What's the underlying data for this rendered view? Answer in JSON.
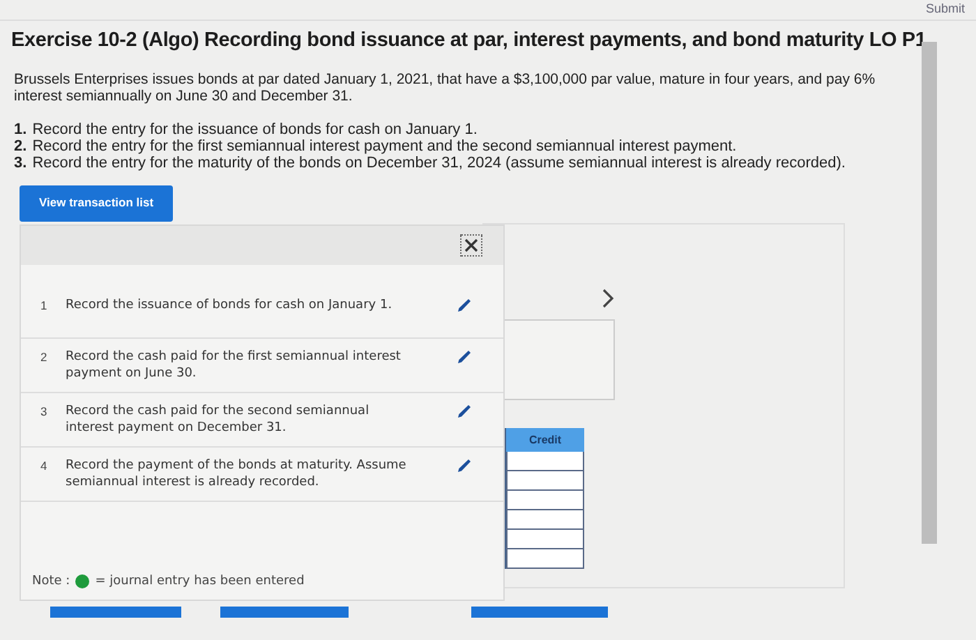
{
  "top_bar": {
    "submit_label": "Submit"
  },
  "title": "Exercise 10-2 (Algo) Recording bond issuance at par, interest payments, and bond maturity LO P1",
  "intro": "Brussels Enterprises issues bonds at par dated January 1, 2021, that have a $3,100,000 par value, mature in four years, and pay 6% interest semiannually on June 30 and December 31.",
  "tasks": [
    {
      "number": "1.",
      "text": "Record the entry for the issuance of bonds for cash on January 1."
    },
    {
      "number": "2.",
      "text": "Record the entry for the first semiannual interest payment and the second semiannual interest payment."
    },
    {
      "number": "3.",
      "text": "Record the entry for the maturity of the bonds on December 31, 2024 (assume semiannual interest is already recorded)."
    }
  ],
  "transaction_button": "View transaction list",
  "transactions": [
    {
      "number": "1",
      "text": "Record the issuance of bonds for cash on January 1."
    },
    {
      "number": "2",
      "text": "Record the cash paid for the first semiannual interest payment on June 30."
    },
    {
      "number": "3",
      "text": "Record the cash paid for the second semiannual interest payment on December 31."
    },
    {
      "number": "4",
      "text": "Record the payment of the bonds at maturity. Assume semiannual interest is already recorded."
    }
  ],
  "note": {
    "label": "Note :",
    "color": "#1e9b3c",
    "text": "= journal entry has been entered"
  },
  "journal": {
    "credit_header": "Credit"
  }
}
